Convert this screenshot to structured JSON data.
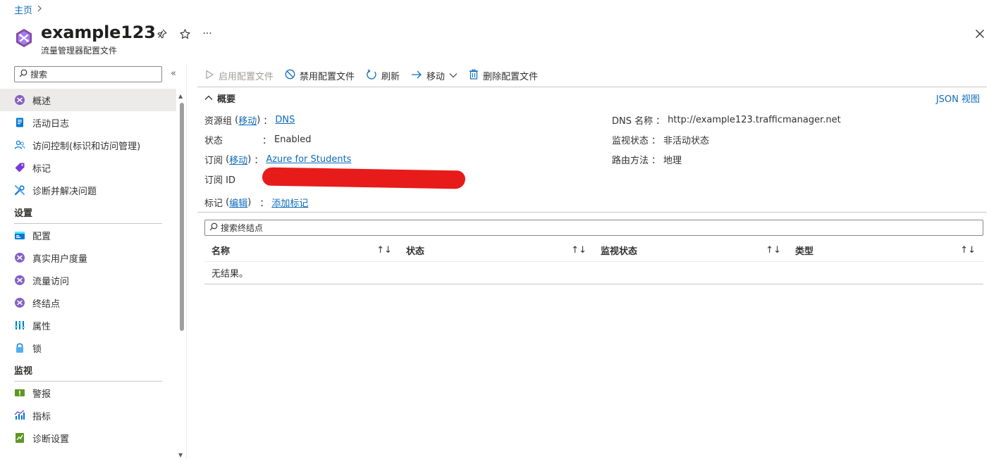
{
  "breadcrumb": {
    "home": "主页",
    "sep": ">"
  },
  "header": {
    "title": "example123",
    "subtitle": "流量管理器配置文件",
    "pin": "pin-icon",
    "favorite": "star-icon",
    "more": "···",
    "close": "close-icon"
  },
  "sidebar": {
    "search_placeholder": "搜索",
    "collapse": "«",
    "items": [
      {
        "label": "概述",
        "icon": "traffic-manager-icon",
        "active": true
      },
      {
        "label": "活动日志",
        "icon": "activity-log-icon"
      },
      {
        "label": "访问控制(标识和访问管理)",
        "icon": "people-icon"
      },
      {
        "label": "标记",
        "icon": "tag-icon"
      },
      {
        "label": "诊断并解决问题",
        "icon": "wrench-icon"
      }
    ],
    "sections": [
      {
        "title": "设置",
        "items": [
          {
            "label": "配置",
            "icon": "config-icon"
          },
          {
            "label": "真实用户度量",
            "icon": "traffic-manager-icon"
          },
          {
            "label": "流量访问",
            "icon": "traffic-manager-icon"
          },
          {
            "label": "终结点",
            "icon": "traffic-manager-icon"
          },
          {
            "label": "属性",
            "icon": "properties-icon"
          },
          {
            "label": "锁",
            "icon": "lock-icon"
          }
        ]
      },
      {
        "title": "监视",
        "items": [
          {
            "label": "警报",
            "icon": "alert-icon"
          },
          {
            "label": "指标",
            "icon": "metrics-icon"
          },
          {
            "label": "诊断设置",
            "icon": "diagnostic-settings-icon"
          }
        ]
      }
    ]
  },
  "toolbar": {
    "enable": "启用配置文件",
    "disable": "禁用配置文件",
    "refresh": "刷新",
    "move": "移动",
    "delete": "删除配置文件"
  },
  "essentials": {
    "title": "概要",
    "json_view": "JSON 视图",
    "resource_group_label": "资源组",
    "move_link": "移动",
    "resource_group_value": "DNS",
    "status_label": "状态",
    "status_value": "Enabled",
    "subscription_label": "订阅",
    "subscription_value": "Azure for Students",
    "subscription_id_label": "订阅 ID",
    "tags_label": "标记",
    "edit_link": "编辑",
    "tags_value": "添加标记",
    "dns_label": "DNS 名称",
    "dns_value": "http://example123.trafficmanager.net",
    "monitor_label": "监视状态",
    "monitor_value": "非活动状态",
    "routing_label": "路由方法",
    "routing_value": "地理",
    "colon": "："
  },
  "endpoints": {
    "search_placeholder": "搜索终结点",
    "columns": [
      "名称",
      "状态",
      "监视状态",
      "类型"
    ],
    "sort_icon": "↑↓",
    "empty": "无结果。"
  },
  "colors": {
    "accent": "#0f6cbd",
    "redaction": "#e81b1b"
  }
}
